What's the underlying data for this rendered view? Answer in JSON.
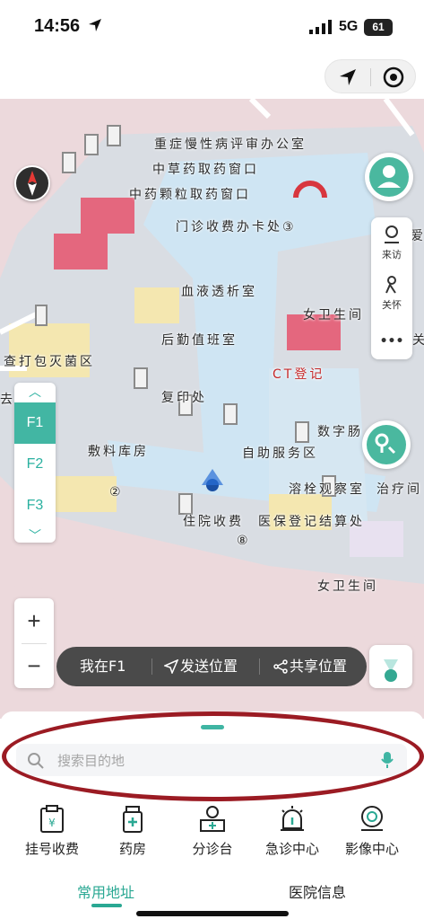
{
  "status_bar": {
    "time": "14:56",
    "network": "5G",
    "battery": "61"
  },
  "map": {
    "labels": [
      "重症慢性病评审办公室",
      "中草药取药窗口",
      "中药颗粒取药窗口",
      "门诊收费办卡处③",
      "血液透析室",
      "女卫生间",
      "后勤值班室",
      "查打包灭菌区",
      "CT登记",
      "复印处",
      "数字肠",
      "敷料库房",
      "自助服务区",
      "溶栓观察室",
      "治疗间",
      "住院收费",
      "医保登记结算处",
      "女卫生间",
      "⑧",
      "②",
      "去",
      "爱",
      "关"
    ],
    "floors": [
      "F1",
      "F2",
      "F3"
    ],
    "active_floor": "F1",
    "right_panel": {
      "visit_label": "来访",
      "care_label": "关怀",
      "more_label": "•••"
    },
    "zoom": {
      "in": "+",
      "out": "−"
    },
    "location_bar": {
      "current": "我在F1",
      "send": "发送位置",
      "share": "共享位置"
    }
  },
  "search": {
    "placeholder": "搜索目的地"
  },
  "quick_access": [
    {
      "label": "挂号收费",
      "icon": "registration-icon"
    },
    {
      "label": "药房",
      "icon": "pharmacy-icon"
    },
    {
      "label": "分诊台",
      "icon": "triage-desk-icon"
    },
    {
      "label": "急诊中心",
      "icon": "emergency-light-icon"
    },
    {
      "label": "影像中心",
      "icon": "imaging-scanner-icon"
    }
  ],
  "tabs": [
    {
      "label": "常用地址",
      "active": true
    },
    {
      "label": "医院信息",
      "active": false
    }
  ],
  "colors": {
    "accent": "#2aa893",
    "annotation_oval": "#9b1b23",
    "corridor": "#cfe5f3",
    "room_pink": "#e4677e",
    "room_yellow": "#f4e7b0"
  }
}
